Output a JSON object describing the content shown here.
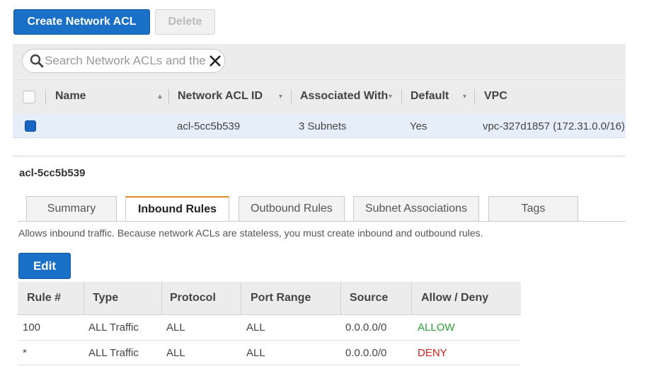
{
  "toolbar": {
    "create_label": "Create Network ACL",
    "delete_label": "Delete"
  },
  "search": {
    "placeholder": "Search Network ACLs and the"
  },
  "list": {
    "columns": {
      "name": "Name",
      "acl_id": "Network ACL ID",
      "associated": "Associated With",
      "default": "Default",
      "vpc": "VPC"
    },
    "rows": [
      {
        "name": "",
        "acl_id": "acl-5cc5b539",
        "associated": "3 Subnets",
        "default": "Yes",
        "vpc": "vpc-327d1857 (172.31.0.0/16)",
        "selected": true
      }
    ]
  },
  "detail": {
    "title": "acl-5cc5b539",
    "tabs": [
      "Summary",
      "Inbound Rules",
      "Outbound Rules",
      "Subnet Associations",
      "Tags"
    ],
    "active_tab": "Inbound Rules",
    "description": "Allows inbound traffic. Because network ACLs are stateless, you must create inbound and outbound rules.",
    "edit_label": "Edit",
    "rules": {
      "columns": [
        "Rule #",
        "Type",
        "Protocol",
        "Port Range",
        "Source",
        "Allow / Deny"
      ],
      "rows": [
        [
          "100",
          "ALL Traffic",
          "ALL",
          "ALL",
          "0.0.0.0/0",
          "ALLOW"
        ],
        [
          "*",
          "ALL Traffic",
          "ALL",
          "ALL",
          "0.0.0.0/0",
          "DENY"
        ]
      ]
    }
  },
  "colors": {
    "primary": "#1a6fc7",
    "allow": "#2e9e3a",
    "deny": "#d21d1d",
    "active_tab_accent": "#e38a2c"
  },
  "icons": {
    "search": "search-icon",
    "clear": "close-icon",
    "sort_asc": "sort-asc-icon",
    "sort": "chevron-down-icon"
  }
}
